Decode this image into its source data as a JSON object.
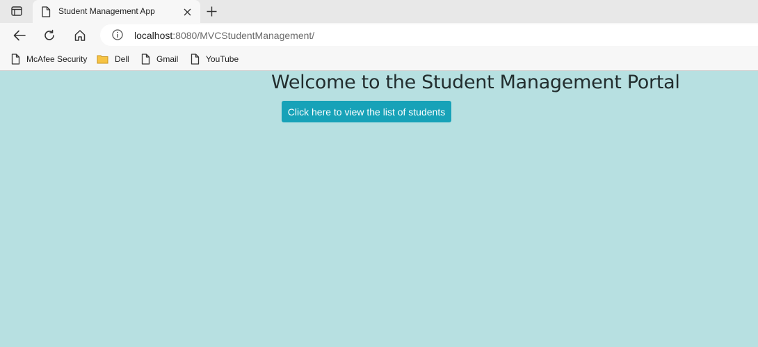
{
  "browser": {
    "tab": {
      "title": "Student Management App",
      "icon": "page-icon"
    },
    "address": {
      "host": "localhost",
      "rest": ":8080/MVCStudentManagement/"
    },
    "bookmarks": [
      {
        "label": "McAfee Security",
        "icon": "page-icon"
      },
      {
        "label": "Dell",
        "icon": "folder-icon"
      },
      {
        "label": "Gmail",
        "icon": "page-icon"
      },
      {
        "label": "YouTube",
        "icon": "page-icon"
      }
    ],
    "colors": {
      "tabstrip": "#e8e8e8",
      "toolbar": "#f7f7f7",
      "folder": "#f6c344"
    }
  },
  "page": {
    "title": "Welcome to the Student Management Portal",
    "button_label": "Click here to view the list of students",
    "colors": {
      "background": "#b7e0e1",
      "button": "#17a2b8",
      "title": "#222d2e"
    }
  }
}
